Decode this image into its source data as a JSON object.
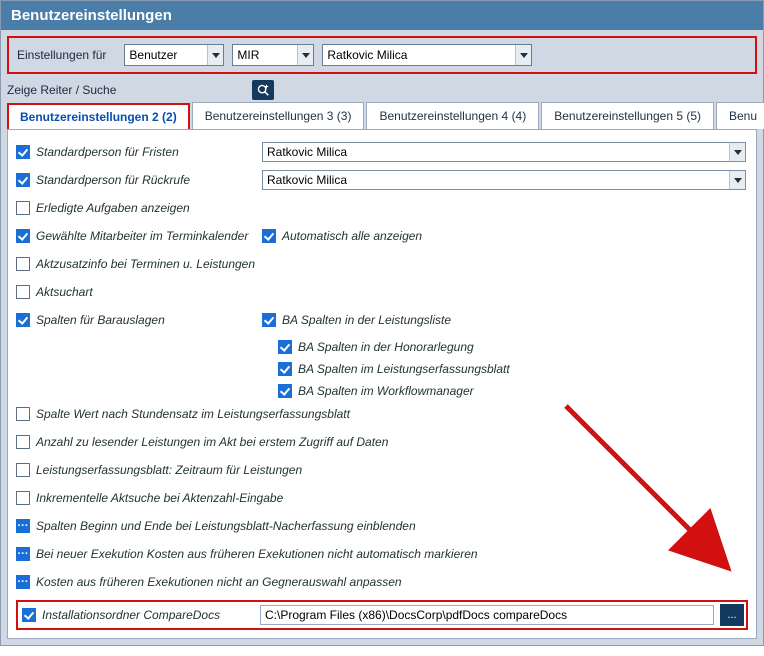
{
  "title": "Benutzereinstellungen",
  "filter": {
    "label": "Einstellungen für",
    "settings_for": "Benutzer",
    "code": "MIR",
    "person": "Ratkovic Milica"
  },
  "search": {
    "label": "Zeige Reiter / Suche"
  },
  "tabs": {
    "t1": "Benutzereinstellungen 2 (2)",
    "t2": "Benutzereinstellungen 3 (3)",
    "t3": "Benutzereinstellungen 4 (4)",
    "t4": "Benutzereinstellungen 5 (5)",
    "t5": "Benu"
  },
  "rows": {
    "r1": "Standardperson für Fristen",
    "r1v": "Ratkovic Milica",
    "r2": "Standardperson für Rückrufe",
    "r2v": "Ratkovic Milica",
    "r3": "Erledigte Aufgaben anzeigen",
    "r4": "Gewählte Mitarbeiter im Terminkalender",
    "r4b": "Automatisch alle anzeigen",
    "r5": "Aktzusatzinfo bei Terminen u. Leistungen",
    "r6": "Aktsuchart",
    "r7": "Spalten für Barauslagen",
    "ba1": "BA Spalten in der Leistungsliste",
    "ba2": "BA Spalten in der Honorarlegung",
    "ba3": "BA Spalten im Leistungserfassungsblatt",
    "ba4": "BA Spalten im Workflowmanager",
    "r8": "Spalte Wert nach Stundensatz im Leistungserfassungsblatt",
    "r9": "Anzahl zu lesender Leistungen im Akt bei erstem Zugriff auf Daten",
    "r10": "Leistungserfassungsblatt: Zeitraum für Leistungen",
    "r11": "Inkrementelle Aktsuche bei Aktenzahl-Eingabe",
    "r12": "Spalten Beginn und Ende bei Leistungsblatt-Nacherfassung einblenden",
    "r13": "Bei neuer Exekution Kosten aus früheren Exekutionen nicht automatisch markieren",
    "r14": "Kosten aus früheren Exekutionen nicht an Gegnerauswahl anpassen",
    "r15": "Installationsordner CompareDocs",
    "r15v": "C:\\Program Files (x86)\\DocsCorp\\pdfDocs compareDocs"
  },
  "dots_label": "..."
}
